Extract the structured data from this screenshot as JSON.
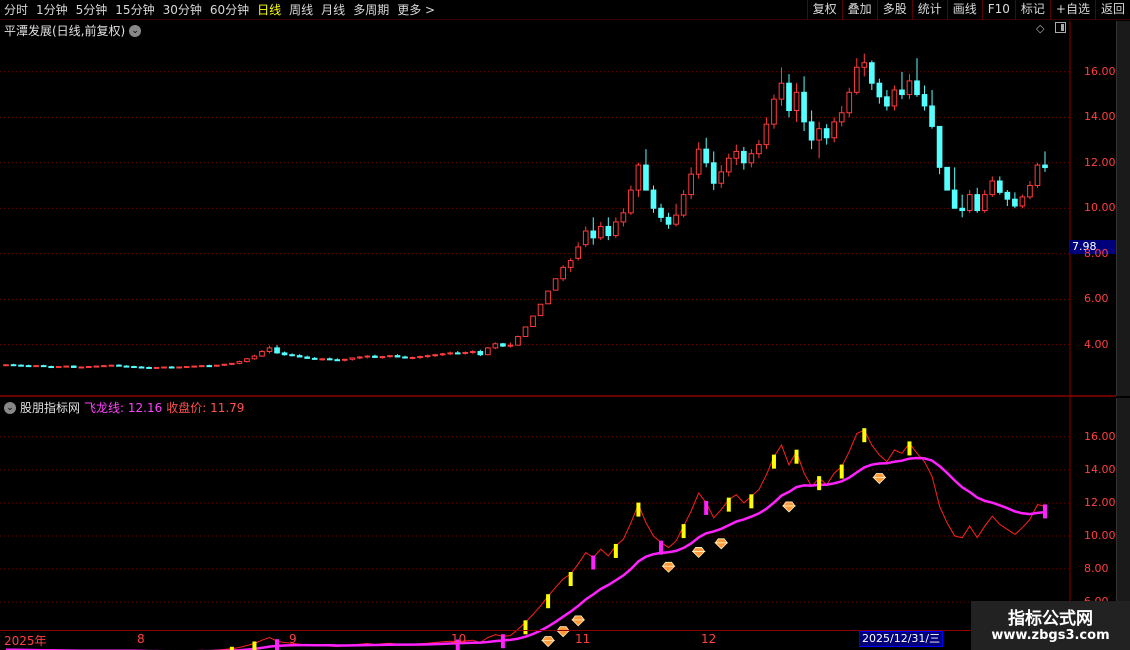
{
  "toolbar": {
    "periods": [
      {
        "label": "分时",
        "active": false
      },
      {
        "label": "1分钟",
        "active": false
      },
      {
        "label": "5分钟",
        "active": false
      },
      {
        "label": "15分钟",
        "active": false
      },
      {
        "label": "30分钟",
        "active": false
      },
      {
        "label": "60分钟",
        "active": false
      },
      {
        "label": "日线",
        "active": true
      },
      {
        "label": "周线",
        "active": false
      },
      {
        "label": "月线",
        "active": false
      },
      {
        "label": "多周期",
        "active": false
      },
      {
        "label": "更多 >",
        "active": false
      }
    ],
    "buttons": [
      "复权",
      "叠加",
      "多股",
      "统计",
      "画线",
      "F10",
      "标记",
      "+自选",
      "返回"
    ]
  },
  "main_chart": {
    "title": "平潭发展(日线,前复权)",
    "price_tag": "7.98",
    "y_ticks": [
      "16.00",
      "14.00",
      "12.00",
      "10.00",
      "8.00",
      "6.00",
      "4.00"
    ]
  },
  "indicator": {
    "name": "股朋指标网",
    "line1_label": "飞龙线: 12.16",
    "line2_label": "收盘价: 11.79",
    "y_ticks": [
      "16.00",
      "14.00",
      "12.00",
      "10.00",
      "8.00",
      "6.00"
    ]
  },
  "dates": {
    "labels": [
      {
        "text": "2025年",
        "left": 4
      },
      {
        "text": "8",
        "left": 137
      },
      {
        "text": "9",
        "left": 289
      },
      {
        "text": "10",
        "left": 451
      },
      {
        "text": "11",
        "left": 575
      },
      {
        "text": "12",
        "left": 701
      }
    ],
    "cursor": "2025/12/31/三"
  },
  "watermark": {
    "line1": "指标公式网",
    "line2": "www.zbgs3.com"
  },
  "colors": {
    "up": "#ff3b3b",
    "down": "#54ffff",
    "fly_line": "#ff22ff",
    "close_line": "#ff2020",
    "grid": "#8b0000",
    "signal": "#ffff00"
  },
  "chart_data": {
    "type": "candlestick",
    "series": [
      {
        "name": "飞龙线",
        "current": 12.16
      },
      {
        "name": "收盘价",
        "current": 11.79
      }
    ],
    "ylim_main": [
      2.8,
      17.4
    ],
    "ylim_indicator": [
      4.8,
      17.5
    ],
    "candles": [
      {
        "o": 3.1,
        "h": 3.14,
        "l": 3.06,
        "c": 3.12
      },
      {
        "o": 3.12,
        "h": 3.16,
        "l": 3.08,
        "c": 3.1
      },
      {
        "o": 3.1,
        "h": 3.14,
        "l": 3.06,
        "c": 3.08
      },
      {
        "o": 3.08,
        "h": 3.12,
        "l": 3.04,
        "c": 3.06
      },
      {
        "o": 3.06,
        "h": 3.1,
        "l": 3.02,
        "c": 3.08
      },
      {
        "o": 3.08,
        "h": 3.12,
        "l": 3.04,
        "c": 3.04
      },
      {
        "o": 3.04,
        "h": 3.08,
        "l": 3.0,
        "c": 3.02
      },
      {
        "o": 3.02,
        "h": 3.06,
        "l": 2.98,
        "c": 3.04
      },
      {
        "o": 3.04,
        "h": 3.08,
        "l": 3.0,
        "c": 3.06
      },
      {
        "o": 3.06,
        "h": 3.1,
        "l": 3.02,
        "c": 3.0
      },
      {
        "o": 3.0,
        "h": 3.04,
        "l": 2.96,
        "c": 3.02
      },
      {
        "o": 3.02,
        "h": 3.06,
        "l": 2.98,
        "c": 3.04
      },
      {
        "o": 3.04,
        "h": 3.08,
        "l": 3.0,
        "c": 3.06
      },
      {
        "o": 3.06,
        "h": 3.1,
        "l": 3.02,
        "c": 3.08
      },
      {
        "o": 3.08,
        "h": 3.12,
        "l": 3.04,
        "c": 3.1
      },
      {
        "o": 3.1,
        "h": 3.14,
        "l": 3.06,
        "c": 3.06
      },
      {
        "o": 3.06,
        "h": 3.1,
        "l": 3.02,
        "c": 3.04
      },
      {
        "o": 3.04,
        "h": 3.08,
        "l": 3.0,
        "c": 3.02
      },
      {
        "o": 3.02,
        "h": 3.06,
        "l": 2.98,
        "c": 3.0
      },
      {
        "o": 3.0,
        "h": 3.04,
        "l": 2.96,
        "c": 2.98
      },
      {
        "o": 2.98,
        "h": 3.02,
        "l": 2.94,
        "c": 3.0
      },
      {
        "o": 3.0,
        "h": 3.04,
        "l": 2.96,
        "c": 3.02
      },
      {
        "o": 3.02,
        "h": 3.06,
        "l": 2.98,
        "c": 3.0
      },
      {
        "o": 3.0,
        "h": 3.04,
        "l": 2.96,
        "c": 3.02
      },
      {
        "o": 3.02,
        "h": 3.06,
        "l": 2.98,
        "c": 3.04
      },
      {
        "o": 3.04,
        "h": 3.08,
        "l": 3.0,
        "c": 3.06
      },
      {
        "o": 3.06,
        "h": 3.1,
        "l": 3.02,
        "c": 3.08
      },
      {
        "o": 3.08,
        "h": 3.12,
        "l": 3.04,
        "c": 3.06
      },
      {
        "o": 3.06,
        "h": 3.1,
        "l": 3.02,
        "c": 3.1
      },
      {
        "o": 3.1,
        "h": 3.16,
        "l": 3.06,
        "c": 3.14
      },
      {
        "o": 3.14,
        "h": 3.2,
        "l": 3.1,
        "c": 3.18
      },
      {
        "o": 3.18,
        "h": 3.3,
        "l": 3.14,
        "c": 3.26
      },
      {
        "o": 3.26,
        "h": 3.42,
        "l": 3.22,
        "c": 3.38
      },
      {
        "o": 3.38,
        "h": 3.56,
        "l": 3.34,
        "c": 3.5
      },
      {
        "o": 3.5,
        "h": 3.76,
        "l": 3.46,
        "c": 3.7
      },
      {
        "o": 3.7,
        "h": 3.96,
        "l": 3.62,
        "c": 3.86
      },
      {
        "o": 3.86,
        "h": 3.98,
        "l": 3.6,
        "c": 3.64
      },
      {
        "o": 3.64,
        "h": 3.7,
        "l": 3.52,
        "c": 3.56
      },
      {
        "o": 3.56,
        "h": 3.62,
        "l": 3.48,
        "c": 3.52
      },
      {
        "o": 3.52,
        "h": 3.58,
        "l": 3.44,
        "c": 3.46
      },
      {
        "o": 3.46,
        "h": 3.52,
        "l": 3.38,
        "c": 3.4
      },
      {
        "o": 3.4,
        "h": 3.46,
        "l": 3.34,
        "c": 3.36
      },
      {
        "o": 3.36,
        "h": 3.42,
        "l": 3.3,
        "c": 3.38
      },
      {
        "o": 3.38,
        "h": 3.44,
        "l": 3.32,
        "c": 3.34
      },
      {
        "o": 3.34,
        "h": 3.4,
        "l": 3.28,
        "c": 3.32
      },
      {
        "o": 3.32,
        "h": 3.38,
        "l": 3.26,
        "c": 3.36
      },
      {
        "o": 3.36,
        "h": 3.44,
        "l": 3.3,
        "c": 3.42
      },
      {
        "o": 3.42,
        "h": 3.5,
        "l": 3.36,
        "c": 3.46
      },
      {
        "o": 3.46,
        "h": 3.54,
        "l": 3.4,
        "c": 3.5
      },
      {
        "o": 3.5,
        "h": 3.56,
        "l": 3.42,
        "c": 3.44
      },
      {
        "o": 3.44,
        "h": 3.5,
        "l": 3.38,
        "c": 3.48
      },
      {
        "o": 3.48,
        "h": 3.54,
        "l": 3.42,
        "c": 3.52
      },
      {
        "o": 3.52,
        "h": 3.58,
        "l": 3.46,
        "c": 3.46
      },
      {
        "o": 3.46,
        "h": 3.52,
        "l": 3.4,
        "c": 3.42
      },
      {
        "o": 3.42,
        "h": 3.48,
        "l": 3.36,
        "c": 3.44
      },
      {
        "o": 3.44,
        "h": 3.52,
        "l": 3.38,
        "c": 3.48
      },
      {
        "o": 3.48,
        "h": 3.56,
        "l": 3.42,
        "c": 3.52
      },
      {
        "o": 3.52,
        "h": 3.6,
        "l": 3.46,
        "c": 3.56
      },
      {
        "o": 3.56,
        "h": 3.64,
        "l": 3.5,
        "c": 3.6
      },
      {
        "o": 3.6,
        "h": 3.7,
        "l": 3.54,
        "c": 3.64
      },
      {
        "o": 3.64,
        "h": 3.72,
        "l": 3.58,
        "c": 3.62
      },
      {
        "o": 3.62,
        "h": 3.7,
        "l": 3.56,
        "c": 3.66
      },
      {
        "o": 3.66,
        "h": 3.76,
        "l": 3.6,
        "c": 3.7
      },
      {
        "o": 3.7,
        "h": 3.78,
        "l": 3.5,
        "c": 3.56
      },
      {
        "o": 3.56,
        "h": 3.9,
        "l": 3.54,
        "c": 3.86
      },
      {
        "o": 3.86,
        "h": 4.1,
        "l": 3.8,
        "c": 4.04
      },
      {
        "o": 4.04,
        "h": 4.08,
        "l": 3.9,
        "c": 3.94
      },
      {
        "o": 3.94,
        "h": 4.1,
        "l": 3.88,
        "c": 3.98
      },
      {
        "o": 3.98,
        "h": 4.4,
        "l": 3.96,
        "c": 4.36
      },
      {
        "o": 4.36,
        "h": 4.8,
        "l": 4.34,
        "c": 4.78
      },
      {
        "o": 4.8,
        "h": 5.26,
        "l": 4.8,
        "c": 5.26
      },
      {
        "o": 5.28,
        "h": 5.78,
        "l": 5.28,
        "c": 5.78
      },
      {
        "o": 5.8,
        "h": 6.36,
        "l": 5.8,
        "c": 6.36
      },
      {
        "o": 6.4,
        "h": 6.9,
        "l": 6.4,
        "c": 6.9
      },
      {
        "o": 6.9,
        "h": 7.5,
        "l": 6.8,
        "c": 7.4
      },
      {
        "o": 7.4,
        "h": 7.8,
        "l": 7.2,
        "c": 7.7
      },
      {
        "o": 7.8,
        "h": 8.5,
        "l": 7.7,
        "c": 8.3
      },
      {
        "o": 8.4,
        "h": 9.2,
        "l": 8.3,
        "c": 9.0
      },
      {
        "o": 9.0,
        "h": 9.6,
        "l": 8.4,
        "c": 8.7
      },
      {
        "o": 8.7,
        "h": 9.4,
        "l": 8.6,
        "c": 9.2
      },
      {
        "o": 9.2,
        "h": 9.6,
        "l": 8.6,
        "c": 8.8
      },
      {
        "o": 8.8,
        "h": 9.6,
        "l": 8.7,
        "c": 9.4
      },
      {
        "o": 9.4,
        "h": 10.0,
        "l": 9.2,
        "c": 9.8
      },
      {
        "o": 9.8,
        "h": 11.0,
        "l": 9.7,
        "c": 10.8
      },
      {
        "o": 10.8,
        "h": 12.0,
        "l": 10.5,
        "c": 11.9
      },
      {
        "o": 11.9,
        "h": 12.6,
        "l": 10.8,
        "c": 10.8
      },
      {
        "o": 10.8,
        "h": 11.0,
        "l": 9.8,
        "c": 10.0
      },
      {
        "o": 10.0,
        "h": 10.2,
        "l": 9.4,
        "c": 9.6
      },
      {
        "o": 9.6,
        "h": 9.8,
        "l": 9.1,
        "c": 9.3
      },
      {
        "o": 9.3,
        "h": 10.2,
        "l": 9.2,
        "c": 9.7
      },
      {
        "o": 9.7,
        "h": 10.8,
        "l": 9.6,
        "c": 10.6
      },
      {
        "o": 10.6,
        "h": 11.8,
        "l": 10.4,
        "c": 11.5
      },
      {
        "o": 11.5,
        "h": 12.9,
        "l": 11.3,
        "c": 12.6
      },
      {
        "o": 12.6,
        "h": 13.1,
        "l": 11.8,
        "c": 12.0
      },
      {
        "o": 12.0,
        "h": 12.5,
        "l": 10.8,
        "c": 11.1
      },
      {
        "o": 11.1,
        "h": 11.9,
        "l": 10.9,
        "c": 11.6
      },
      {
        "o": 11.6,
        "h": 12.4,
        "l": 11.4,
        "c": 12.2
      },
      {
        "o": 12.2,
        "h": 12.8,
        "l": 11.9,
        "c": 12.5
      },
      {
        "o": 12.5,
        "h": 12.7,
        "l": 11.7,
        "c": 12.0
      },
      {
        "o": 12.0,
        "h": 12.6,
        "l": 11.8,
        "c": 12.4
      },
      {
        "o": 12.4,
        "h": 13.0,
        "l": 12.2,
        "c": 12.8
      },
      {
        "o": 12.8,
        "h": 14.0,
        "l": 12.6,
        "c": 13.7
      },
      {
        "o": 13.7,
        "h": 15.0,
        "l": 13.5,
        "c": 14.8
      },
      {
        "o": 14.8,
        "h": 16.2,
        "l": 14.5,
        "c": 15.5
      },
      {
        "o": 15.5,
        "h": 15.9,
        "l": 14.0,
        "c": 14.3
      },
      {
        "o": 14.3,
        "h": 15.5,
        "l": 13.8,
        "c": 15.1
      },
      {
        "o": 15.1,
        "h": 15.8,
        "l": 13.4,
        "c": 13.8
      },
      {
        "o": 13.8,
        "h": 14.3,
        "l": 12.6,
        "c": 13.0
      },
      {
        "o": 13.0,
        "h": 13.8,
        "l": 12.2,
        "c": 13.5
      },
      {
        "o": 13.5,
        "h": 13.7,
        "l": 12.8,
        "c": 13.1
      },
      {
        "o": 13.1,
        "h": 14.0,
        "l": 12.9,
        "c": 13.8
      },
      {
        "o": 13.8,
        "h": 14.5,
        "l": 13.6,
        "c": 14.2
      },
      {
        "o": 14.2,
        "h": 15.3,
        "l": 14.0,
        "c": 15.1
      },
      {
        "o": 15.1,
        "h": 16.6,
        "l": 15.0,
        "c": 16.2
      },
      {
        "o": 16.2,
        "h": 16.8,
        "l": 15.8,
        "c": 16.4
      },
      {
        "o": 16.4,
        "h": 16.5,
        "l": 15.2,
        "c": 15.5
      },
      {
        "o": 15.5,
        "h": 15.7,
        "l": 14.6,
        "c": 14.9
      },
      {
        "o": 14.9,
        "h": 15.2,
        "l": 14.3,
        "c": 14.5
      },
      {
        "o": 14.5,
        "h": 15.4,
        "l": 14.3,
        "c": 15.2
      },
      {
        "o": 15.2,
        "h": 16.0,
        "l": 14.8,
        "c": 15.0
      },
      {
        "o": 15.0,
        "h": 15.9,
        "l": 14.8,
        "c": 15.6
      },
      {
        "o": 15.6,
        "h": 16.6,
        "l": 14.9,
        "c": 15.0
      },
      {
        "o": 15.0,
        "h": 15.4,
        "l": 14.3,
        "c": 14.5
      },
      {
        "o": 14.5,
        "h": 15.2,
        "l": 13.5,
        "c": 13.6
      },
      {
        "o": 13.6,
        "h": 13.6,
        "l": 11.5,
        "c": 11.8
      },
      {
        "o": 11.8,
        "h": 11.8,
        "l": 10.8,
        "c": 10.8
      },
      {
        "o": 10.8,
        "h": 11.8,
        "l": 10.6,
        "c": 10.0
      },
      {
        "o": 10.0,
        "h": 10.6,
        "l": 9.6,
        "c": 9.9
      },
      {
        "o": 9.9,
        "h": 10.8,
        "l": 9.8,
        "c": 10.6
      },
      {
        "o": 10.6,
        "h": 10.9,
        "l": 9.8,
        "c": 9.9
      },
      {
        "o": 9.9,
        "h": 10.8,
        "l": 9.8,
        "c": 10.6
      },
      {
        "o": 10.6,
        "h": 11.4,
        "l": 10.5,
        "c": 11.2
      },
      {
        "o": 11.2,
        "h": 11.4,
        "l": 10.6,
        "c": 10.7
      },
      {
        "o": 10.7,
        "h": 10.8,
        "l": 10.1,
        "c": 10.4
      },
      {
        "o": 10.4,
        "h": 10.7,
        "l": 10.0,
        "c": 10.1
      },
      {
        "o": 10.1,
        "h": 10.6,
        "l": 10.0,
        "c": 10.5
      },
      {
        "o": 10.5,
        "h": 11.2,
        "l": 10.4,
        "c": 11.0
      },
      {
        "o": 11.0,
        "h": 12.0,
        "l": 10.9,
        "c": 11.9
      },
      {
        "o": 11.9,
        "h": 12.5,
        "l": 11.6,
        "c": 11.79
      }
    ]
  }
}
